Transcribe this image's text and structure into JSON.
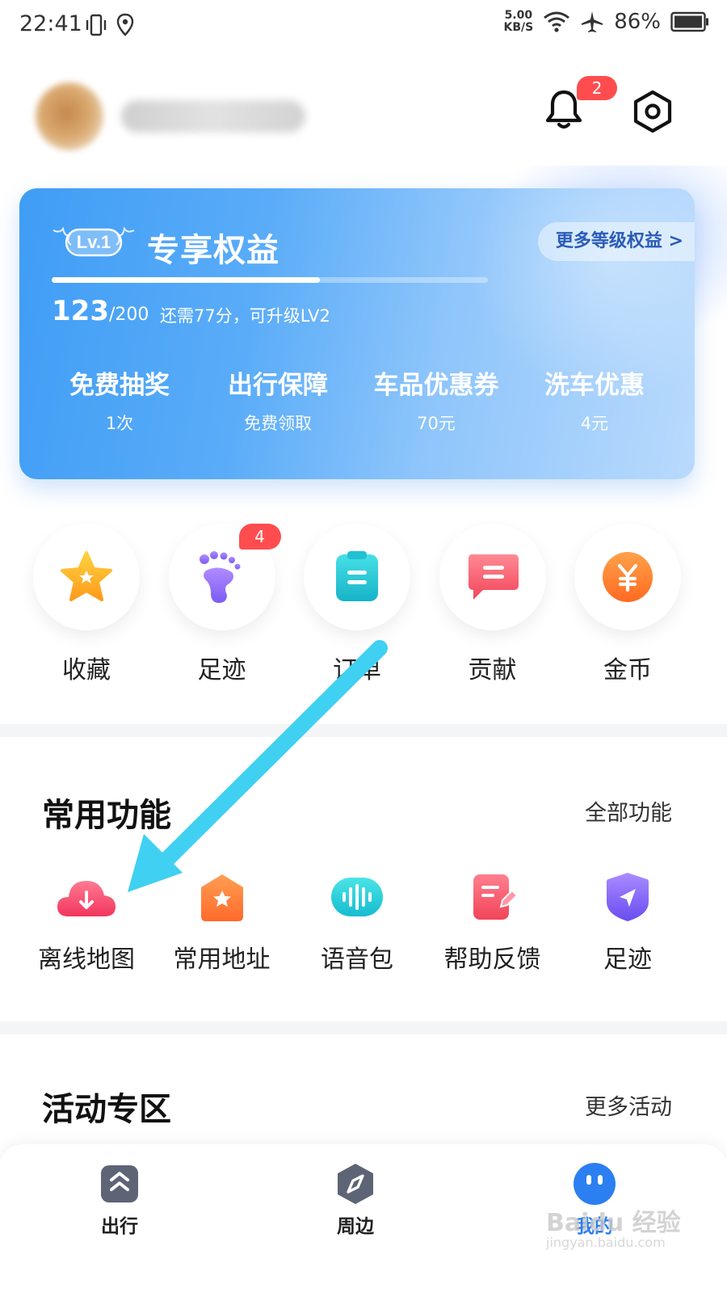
{
  "status_bar": {
    "time": "22:41",
    "net_speed_value": "5.00",
    "net_speed_unit": "KB/S",
    "battery": "86%",
    "icons": [
      "vibrate-icon",
      "location-icon",
      "wifi-icon",
      "airplane-icon",
      "battery-icon"
    ]
  },
  "header": {
    "notification_count": "2",
    "icons": [
      "bell-icon",
      "settings-icon"
    ]
  },
  "membership": {
    "level": "Lv.1",
    "title": "专享权益",
    "more_link": "更多等级权益 >",
    "score_current": "123",
    "score_max": "/200",
    "progress_fraction": 0.615,
    "hint": "还需77分，可升级LV2",
    "perks": [
      {
        "title": "免费抽奖",
        "sub": "1次"
      },
      {
        "title": "出行保障",
        "sub": "免费领取"
      },
      {
        "title": "车品优惠券",
        "sub": "70元"
      },
      {
        "title": "洗车优惠",
        "sub": "4元"
      }
    ]
  },
  "quick": [
    {
      "label": "收藏",
      "icon": "star-icon"
    },
    {
      "label": "足迹",
      "icon": "footprint-icon",
      "badge": "4"
    },
    {
      "label": "订单",
      "icon": "order-icon"
    },
    {
      "label": "贡献",
      "icon": "contribution-icon"
    },
    {
      "label": "金币",
      "icon": "coin-icon"
    }
  ],
  "common": {
    "title": "常用功能",
    "more": "全部功能",
    "items": [
      {
        "label": "离线地图",
        "icon": "offline-map-icon"
      },
      {
        "label": "常用地址",
        "icon": "home-address-icon"
      },
      {
        "label": "语音包",
        "icon": "voice-pack-icon"
      },
      {
        "label": "帮助反馈",
        "icon": "feedback-icon"
      },
      {
        "label": "足迹",
        "icon": "footprint-nav-icon"
      }
    ]
  },
  "activity": {
    "title": "活动专区",
    "more": "更多活动"
  },
  "nav": [
    {
      "label": "出行",
      "icon": "travel-icon"
    },
    {
      "label": "周边",
      "icon": "compass-icon"
    },
    {
      "label": "我的",
      "icon": "profile-icon",
      "active": true
    }
  ],
  "watermark": {
    "text": "Baidu 经验",
    "sub": "jingyan.baidu.com"
  },
  "colors": {
    "accent": "#2b7ff0",
    "card": "#4ea4f7",
    "badge": "#ff4d4f",
    "annotation_arrow": "#3fd0f2"
  }
}
